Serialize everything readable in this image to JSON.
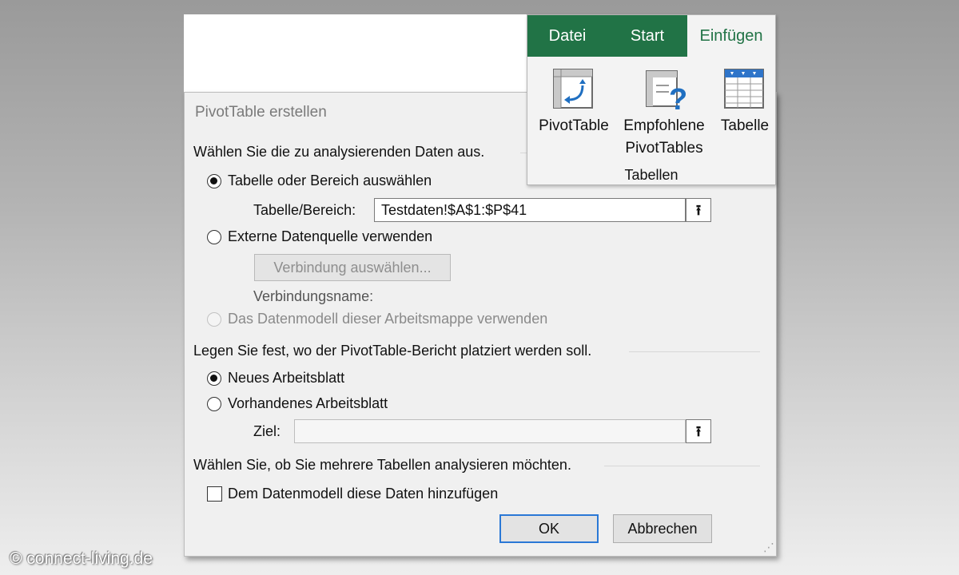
{
  "dialog": {
    "title": "PivotTable erstellen",
    "section1_heading": "Wählen Sie die zu analysierenden Daten aus.",
    "option_table_range": {
      "label": "Tabelle oder Bereich auswählen",
      "selected": true
    },
    "range_field": {
      "label": "Tabelle/Bereich:",
      "value": "Testdaten!$A$1:$P$41"
    },
    "option_external": {
      "label": "Externe Datenquelle verwenden",
      "selected": false
    },
    "connection_button": "Verbindung auswählen...",
    "connection_name_label": "Verbindungsname:",
    "option_datamodel": {
      "label": "Das Datenmodell dieser Arbeitsmappe verwenden",
      "selected": false,
      "disabled": true
    },
    "section2_heading": "Legen Sie fest, wo der PivotTable-Bericht platziert werden soll.",
    "option_new_sheet": {
      "label": "Neues Arbeitsblatt",
      "selected": true
    },
    "option_existing_sheet": {
      "label": "Vorhandenes Arbeitsblatt",
      "selected": false
    },
    "target_field": {
      "label": "Ziel:",
      "value": ""
    },
    "section3_heading": "Wählen Sie, ob Sie mehrere Tabellen analysieren möchten.",
    "add_to_datamodel": {
      "label": "Dem Datenmodell diese Daten hinzufügen",
      "checked": false
    },
    "ok_label": "OK",
    "cancel_label": "Abbrechen",
    "picker_icon": "upload-arrow-icon"
  },
  "ribbon": {
    "tabs": [
      "Datei",
      "Start",
      "Einfügen"
    ],
    "active_tab": "Einfügen",
    "buttons": [
      {
        "label": "PivotTable",
        "icon": "pivottable-icon"
      },
      {
        "label_line1": "Empfohlene",
        "label_line2": "PivotTables",
        "icon": "recommended-pivottables-icon"
      },
      {
        "label": "Tabelle",
        "icon": "table-icon"
      }
    ],
    "group_label": "Tabellen",
    "accent_color": "#217346"
  },
  "watermark": "© connect-living.de"
}
